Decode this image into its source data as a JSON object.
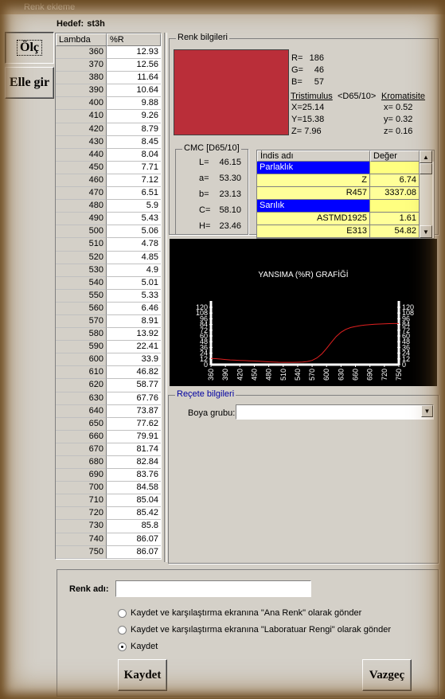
{
  "window": {
    "title": "Renk ekleme"
  },
  "header": {
    "hedef_label": "Hedef:",
    "hedef_value": "st3h"
  },
  "side_buttons": {
    "olc": "Ölç",
    "elle_gir": "Elle gir"
  },
  "spectral_table": {
    "headers": [
      "Lambda",
      "%R"
    ],
    "rows": [
      [
        "360",
        "12.93"
      ],
      [
        "370",
        "12.56"
      ],
      [
        "380",
        "11.64"
      ],
      [
        "390",
        "10.64"
      ],
      [
        "400",
        "9.88"
      ],
      [
        "410",
        "9.26"
      ],
      [
        "420",
        "8.79"
      ],
      [
        "430",
        "8.45"
      ],
      [
        "440",
        "8.04"
      ],
      [
        "450",
        "7.71"
      ],
      [
        "460",
        "7.12"
      ],
      [
        "470",
        "6.51"
      ],
      [
        "480",
        "5.9"
      ],
      [
        "490",
        "5.43"
      ],
      [
        "500",
        "5.06"
      ],
      [
        "510",
        "4.78"
      ],
      [
        "520",
        "4.85"
      ],
      [
        "530",
        "4.9"
      ],
      [
        "540",
        "5.01"
      ],
      [
        "550",
        "5.33"
      ],
      [
        "560",
        "6.46"
      ],
      [
        "570",
        "8.91"
      ],
      [
        "580",
        "13.92"
      ],
      [
        "590",
        "22.41"
      ],
      [
        "600",
        "33.9"
      ],
      [
        "610",
        "46.82"
      ],
      [
        "620",
        "58.77"
      ],
      [
        "630",
        "67.76"
      ],
      [
        "640",
        "73.87"
      ],
      [
        "650",
        "77.62"
      ],
      [
        "660",
        "79.91"
      ],
      [
        "670",
        "81.74"
      ],
      [
        "680",
        "82.84"
      ],
      [
        "690",
        "83.76"
      ],
      [
        "700",
        "84.58"
      ],
      [
        "710",
        "85.04"
      ],
      [
        "720",
        "85.42"
      ],
      [
        "730",
        "85.8"
      ],
      [
        "740",
        "86.07"
      ],
      [
        "750",
        "86.07"
      ]
    ]
  },
  "renk_bilgileri": {
    "legend": "Renk bilgileri",
    "swatch_color": "#ba2e39",
    "rgb": {
      "r_label": "R=",
      "r": "186",
      "g_label": "G=",
      "g": "46",
      "b_label": "B=",
      "b": "57"
    },
    "tristimulus_label": "Tristimulus",
    "illuminant": "<D65/10>",
    "kromatisite_label": "Kromatisite",
    "X": "X=25.14",
    "Y": "Y=15.38",
    "Z": "Z= 7.96",
    "x": "x=  0.52",
    "y": "y=  0.32",
    "z": "z=  0.16"
  },
  "cmc": {
    "legend": "CMC [D65/10]",
    "L_label": "L=",
    "L": "46.15",
    "a_label": "a=",
    "a": "53.30",
    "b_label": "b=",
    "b": "23.13",
    "C_label": "C=",
    "C": "58.10",
    "H_label": "H=",
    "H": "23.46"
  },
  "index_grid": {
    "headers": [
      "İndis adı",
      "Değer"
    ],
    "rows": [
      {
        "type": "group",
        "name": "Parlaklık",
        "value": ""
      },
      {
        "type": "item",
        "name": "Z",
        "value": "6.74"
      },
      {
        "type": "item",
        "name": "R457",
        "value": "3337.08"
      },
      {
        "type": "group",
        "name": "Sarılık",
        "value": ""
      },
      {
        "type": "item",
        "name": "ASTMD1925",
        "value": "1.61"
      },
      {
        "type": "item",
        "name": "E313",
        "value": "54.82"
      }
    ]
  },
  "chart_data": {
    "type": "line",
    "title": "YANSIMA (%R) GRAFİĞİ",
    "x": [
      360,
      370,
      380,
      390,
      400,
      410,
      420,
      430,
      440,
      450,
      460,
      470,
      480,
      490,
      500,
      510,
      520,
      530,
      540,
      550,
      560,
      570,
      580,
      590,
      600,
      610,
      620,
      630,
      640,
      650,
      660,
      670,
      680,
      690,
      700,
      710,
      720,
      730,
      740,
      750
    ],
    "series": [
      {
        "values": [
          12.93,
          12.56,
          11.64,
          10.64,
          9.88,
          9.26,
          8.79,
          8.45,
          8.04,
          7.71,
          7.12,
          6.51,
          5.9,
          5.43,
          5.06,
          4.78,
          4.85,
          4.9,
          5.01,
          5.33,
          6.46,
          8.91,
          13.92,
          22.41,
          33.9,
          46.82,
          58.77,
          67.76,
          73.87,
          77.62,
          79.91,
          81.74,
          82.84,
          83.76,
          84.58,
          85.04,
          85.42,
          85.8,
          86.07,
          86.07
        ],
        "color": "#e02020"
      }
    ],
    "y_ticks": [
      "120",
      "108",
      "96",
      "84",
      "72",
      "60",
      "48",
      "36",
      "24",
      "12",
      "0"
    ],
    "x_ticks": [
      "360",
      "390",
      "420",
      "450",
      "480",
      "510",
      "540",
      "570",
      "600",
      "630",
      "660",
      "690",
      "720",
      "750"
    ],
    "ylim": [
      0,
      120
    ],
    "xlim": [
      360,
      750
    ],
    "background": "#000000",
    "text_color": "#ffffff"
  },
  "recete": {
    "legend": "Reçete bilgileri",
    "boya_grubu_label": "Boya grubu:",
    "boya_grubu_value": ""
  },
  "bottom": {
    "renk_adi_label": "Renk adı:",
    "renk_adi_value": "",
    "options": [
      "Kaydet ve karşılaştırma ekranına \"Ana Renk\" olarak gönder",
      "Kaydet ve karşılaştırma ekranına \"Laboratuar Rengi\" olarak gönder",
      "Kaydet"
    ],
    "selected_option": 2,
    "kaydet_button": "Kaydet",
    "vazgec_button": "Vazgeç"
  }
}
